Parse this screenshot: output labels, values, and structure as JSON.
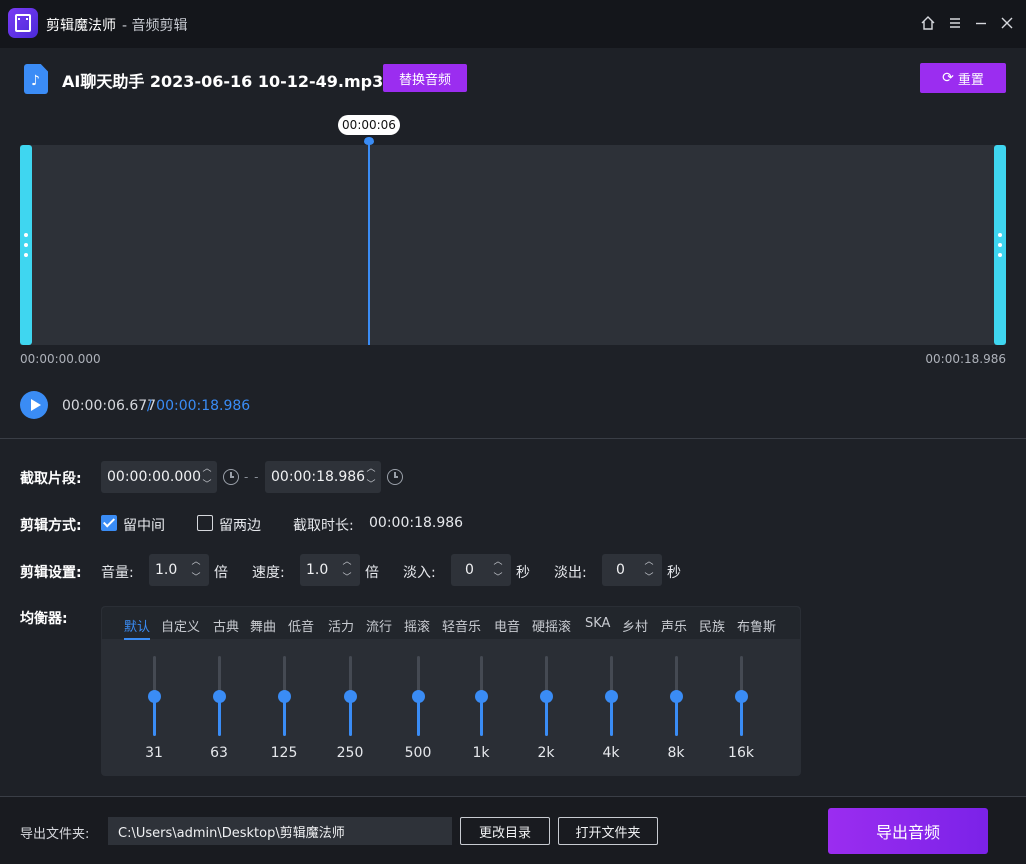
{
  "titlebar": {
    "app_name": "剪辑魔法师",
    "subtitle": "- 音频剪辑"
  },
  "file": {
    "name": "AI聊天助手 2023-06-16 10-12-49.mp3",
    "replace_label": "替换音频",
    "reset_label": "重置"
  },
  "waveform": {
    "playhead_tooltip": "00:00:06",
    "start_time": "00:00:00.000",
    "end_time": "00:00:18.986",
    "playhead_fraction": 0.351
  },
  "player": {
    "current_time": "00:00:06.677",
    "total_time": "/ 00:00:18.986"
  },
  "clip": {
    "label": "截取片段:",
    "start": "00:00:00.000",
    "end": "00:00:18.986",
    "separator": "- -"
  },
  "mode": {
    "label": "剪辑方式:",
    "keep_middle": "留中间",
    "keep_middle_checked": true,
    "keep_sides": "留两边",
    "keep_sides_checked": false,
    "duration_label": "截取时长:",
    "duration_value": "00:00:18.986"
  },
  "settings": {
    "label": "剪辑设置:",
    "volume_label": "音量:",
    "volume_value": "1.0",
    "volume_unit": "倍",
    "speed_label": "速度:",
    "speed_value": "1.0",
    "speed_unit": "倍",
    "fadein_label": "淡入:",
    "fadein_value": "0",
    "fadein_unit": "秒",
    "fadeout_label": "淡出:",
    "fadeout_value": "0",
    "fadeout_unit": "秒"
  },
  "equalizer": {
    "label": "均衡器:",
    "tabs": [
      "默认",
      "自定义",
      "古典",
      "舞曲",
      "低音",
      "活力",
      "流行",
      "摇滚",
      "轻音乐",
      "电音",
      "硬摇滚",
      "SKA",
      "乡村",
      "声乐",
      "民族",
      "布鲁斯"
    ],
    "active_tab": "默认",
    "bands": [
      {
        "freq": "31",
        "level": 0.5
      },
      {
        "freq": "63",
        "level": 0.5
      },
      {
        "freq": "125",
        "level": 0.5
      },
      {
        "freq": "250",
        "level": 0.5
      },
      {
        "freq": "500",
        "level": 0.5
      },
      {
        "freq": "1k",
        "level": 0.5
      },
      {
        "freq": "2k",
        "level": 0.5
      },
      {
        "freq": "4k",
        "level": 0.5
      },
      {
        "freq": "8k",
        "level": 0.5
      },
      {
        "freq": "16k",
        "level": 0.5
      }
    ]
  },
  "export": {
    "folder_label": "导出文件夹:",
    "folder_path": "C:\\Users\\admin\\Desktop\\剪辑魔法师",
    "change_dir_label": "更改目录",
    "open_folder_label": "打开文件夹",
    "export_label": "导出音频"
  },
  "colors": {
    "accent_blue": "#3a8cf5",
    "accent_purple": "#9b2df0",
    "handle_cyan": "#3fd6f0"
  }
}
